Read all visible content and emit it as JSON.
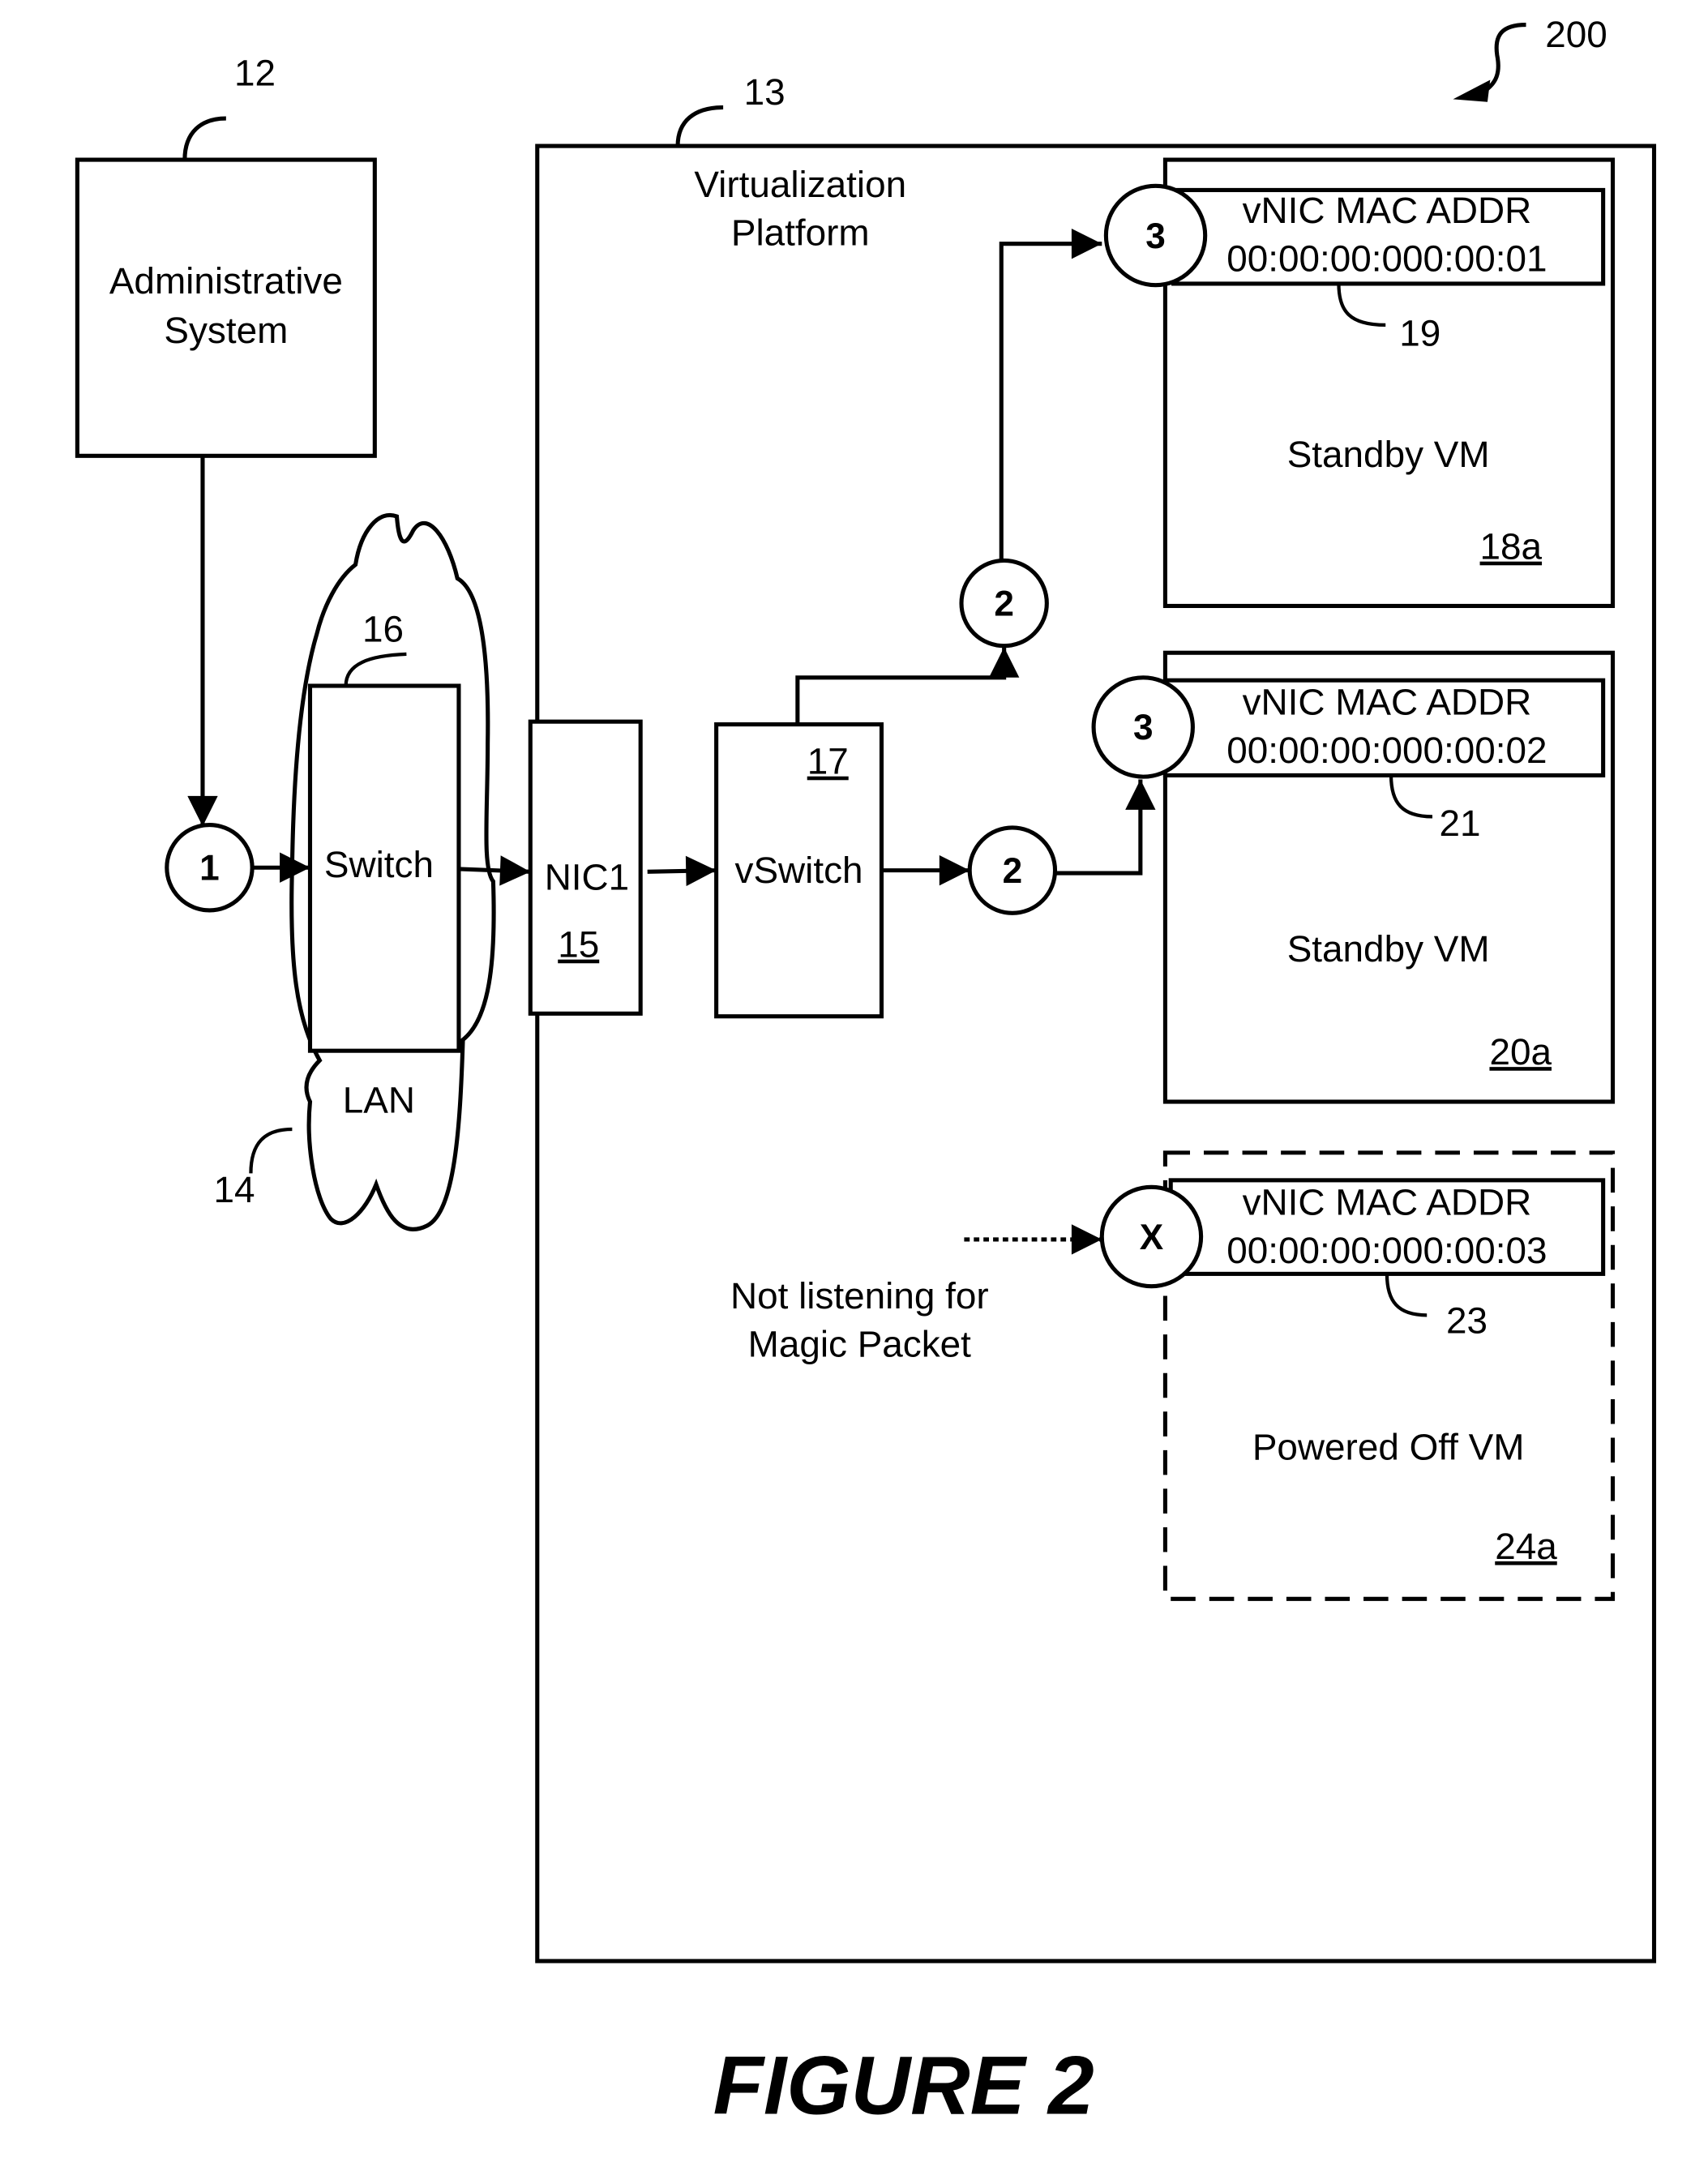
{
  "figure": {
    "title": "FIGURE 2",
    "ref_number": "200"
  },
  "admin_system": {
    "label_line1": "Administrative",
    "label_line2": "System",
    "ref": "12"
  },
  "lan": {
    "label": "LAN",
    "ref": "14"
  },
  "switch": {
    "label": "Switch",
    "ref": "16"
  },
  "platform": {
    "label_line1": "Virtualization",
    "label_line2": "Platform",
    "ref": "13"
  },
  "nic": {
    "label": "NIC1",
    "ref": "15"
  },
  "vswitch": {
    "label": "vSwitch",
    "ref": "17"
  },
  "steps": {
    "step1": "1",
    "step2": "2",
    "step3": "3",
    "stepx": "X"
  },
  "vms": [
    {
      "label": "Standby VM",
      "ref": "18a",
      "vnic_title": "vNIC MAC ADDR",
      "mac": "00:00:00:000:00:01",
      "vnic_ref": "19"
    },
    {
      "label": "Standby VM",
      "ref": "20a",
      "vnic_title": "vNIC MAC ADDR",
      "mac": "00:00:00:000:00:02",
      "vnic_ref": "21"
    },
    {
      "label": "Powered Off VM",
      "ref": "24a",
      "vnic_title": "vNIC MAC ADDR",
      "mac": "00:00:00:000:00:03",
      "vnic_ref": "23"
    }
  ],
  "note": {
    "line1": "Not listening for",
    "line2": "Magic Packet"
  }
}
